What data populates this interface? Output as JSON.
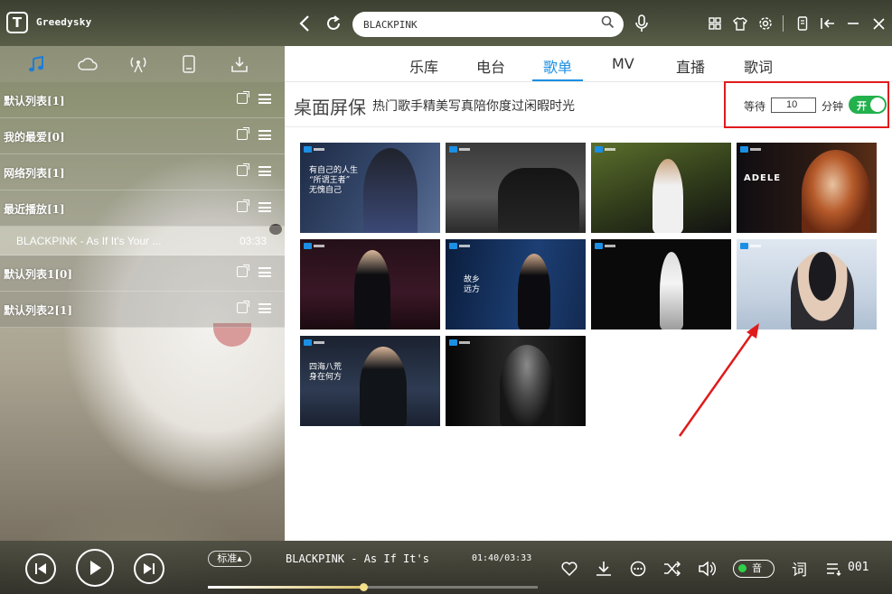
{
  "app": {
    "name": "Greedysky",
    "logo_letter": "T"
  },
  "search": {
    "value": "BLACKPINK"
  },
  "left_tabs": [
    "music-note-icon",
    "cloud-icon",
    "radio-icon",
    "device-icon",
    "download-icon"
  ],
  "playlists": [
    {
      "label": "默认列表[1]"
    },
    {
      "label": "我的最爱[0]"
    },
    {
      "label": "网络列表[1]"
    },
    {
      "label": "最近播放[1]"
    },
    {
      "label": "默认列表1[0]"
    },
    {
      "label": "默认列表2[1]"
    }
  ],
  "recent_song": {
    "title": "BLACKPINK - As If It's Your ...",
    "duration": "03:33"
  },
  "nav_tabs": [
    {
      "label": "乐库"
    },
    {
      "label": "电台"
    },
    {
      "label": "歌单"
    },
    {
      "label": "MV"
    },
    {
      "label": "直播"
    },
    {
      "label": "歌词"
    }
  ],
  "active_tab": "歌单",
  "screensaver": {
    "title": "桌面屏保",
    "subtitle": "热门歌手精美写真陪你度过闲暇时光",
    "wait_label": "等待",
    "minutes": "10",
    "unit": "分钟",
    "toggle_label": "开",
    "enabled": true
  },
  "thumb_texts": [
    "有自己的人生\n“所谓王者”\n无愧自己",
    "",
    "",
    "ADELE",
    "",
    "故乡\n远方",
    "",
    "",
    "四海八荒\n身在何方",
    ""
  ],
  "player": {
    "quality": "标准",
    "title": "BLACKPINK - As If It's",
    "time": "01:40/03:33",
    "progress": 0.47,
    "lyric_toggle": "音",
    "lyric_label": "词",
    "count": "001"
  },
  "colors": {
    "accent": "#1a8fe3",
    "toggle": "#22b14c",
    "highlight": "#e01b1b"
  }
}
